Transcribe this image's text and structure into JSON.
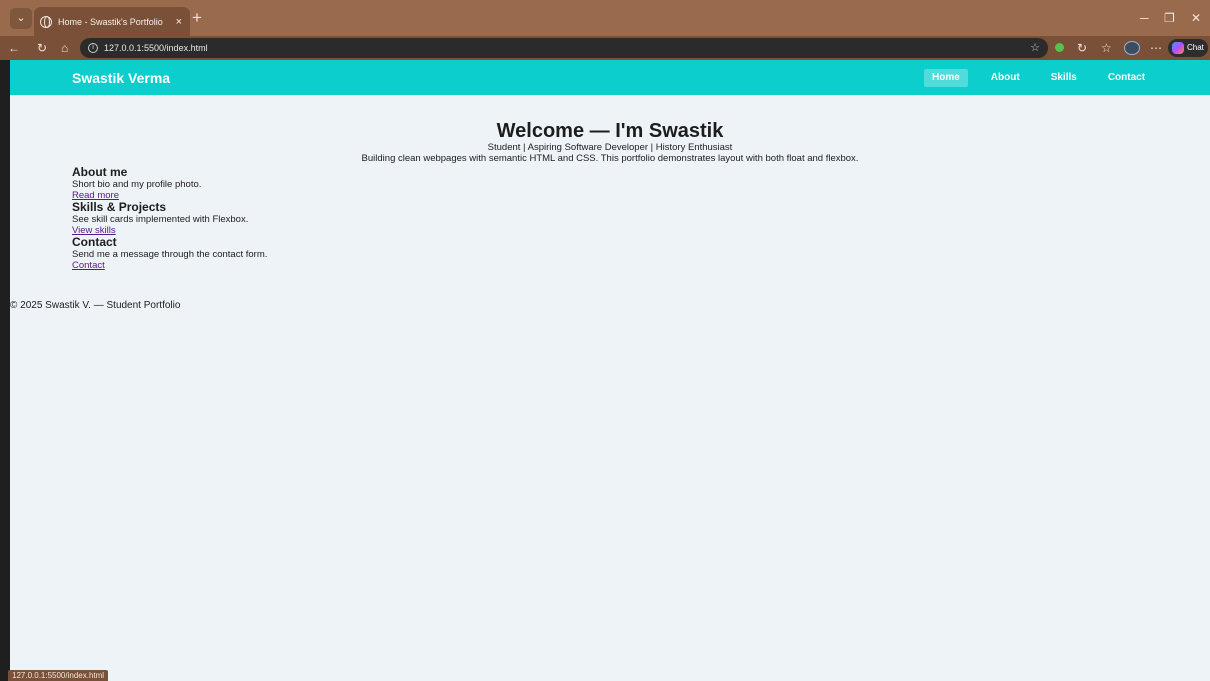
{
  "browser": {
    "tab_title": "Home - Swastik's Portfolio",
    "tab_close": "×",
    "new_tab": "+",
    "url": "127.0.0.1:5500/index.html",
    "copilot_label": "Chat",
    "status_url": "127.0.0.1:5500/index.html",
    "icons": [
      "chevron-down-icon",
      "globe-icon",
      "back-icon",
      "reload-icon",
      "home-icon",
      "info-icon",
      "star-icon",
      "extension-icon",
      "refresh-icon",
      "favorites-icon",
      "profile-avatar",
      "more-icon",
      "copilot-icon",
      "minimize-icon",
      "restore-icon",
      "close-icon"
    ]
  },
  "site": {
    "brand": "Swastik Verma",
    "nav": [
      {
        "label": "Home",
        "active": true
      },
      {
        "label": "About",
        "active": false
      },
      {
        "label": "Skills",
        "active": false
      },
      {
        "label": "Contact",
        "active": false
      }
    ]
  },
  "hero": {
    "title": "Welcome — I'm Swastik",
    "tagline": "Student | Aspiring Software Developer | History Enthusiast",
    "description": "Building clean webpages with semantic HTML and CSS. This portfolio demonstrates layout with both float and flexbox."
  },
  "sections": [
    {
      "heading": "About me",
      "text": "Short bio and my profile photo.",
      "link": "Read more"
    },
    {
      "heading": "Skills & Projects",
      "text": "See skill cards implemented with Flexbox.",
      "link": "View skills"
    },
    {
      "heading": "Contact",
      "text": "Send me a message through the contact form.",
      "link": "Contact"
    }
  ],
  "footer": {
    "text": "© 2025 Swastik V. — Student Portfolio"
  },
  "colors": {
    "header": "#0ccfcd",
    "page_bg": "#eef3f7",
    "browser_frame": "#9a6a4c",
    "link": "#551a8b"
  }
}
